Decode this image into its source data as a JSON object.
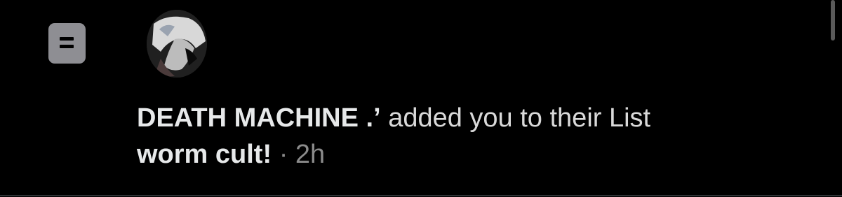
{
  "notification": {
    "type_icon": "list-icon",
    "avatar_icon": "user-avatar",
    "actor_name": "DEATH MACHINE .’",
    "action_text": "added you to their List",
    "list_name": "worm cult!",
    "separator": "·",
    "time": "2h"
  },
  "colors": {
    "background": "#000000",
    "primary_text": "#e7e9ea",
    "secondary_text": "#8b8b8b",
    "icon_bg": "#8e8e93"
  }
}
